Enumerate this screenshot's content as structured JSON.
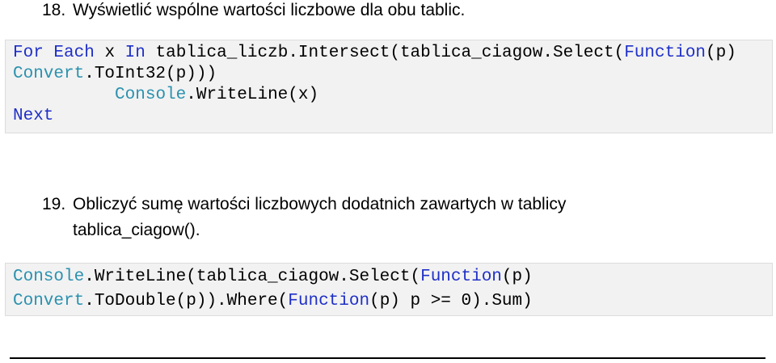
{
  "item18": {
    "number": "18.",
    "text": "Wyświetlić wspólne wartości liczbowe dla obu tablic."
  },
  "code1": {
    "line1": {
      "kw_for": "For",
      "kw_each": "Each",
      "t1": "x",
      "kw_in": "In",
      "t2": "tablica_liczb.Intersect(tablica_ciagow.Select(",
      "kw_function": "Function",
      "t3": "(p)"
    },
    "line2": {
      "ty_convert": "Convert",
      "t1": ".ToInt32(p)))"
    },
    "line3": {
      "ty_console": "Console",
      "t1": ".WriteLine(x)"
    },
    "line4": {
      "kw_next": "Next"
    }
  },
  "item19": {
    "number": "19.",
    "text": "Obliczyć sumę wartości liczbowych dodatnich zawartych w tablicy tablica_ciagow()."
  },
  "code2": {
    "line1": {
      "ty_console": "Console",
      "t1": ".WriteLine(tablica_ciagow.Select(",
      "kw_function": "Function",
      "t2": "(p)"
    },
    "line2": {
      "ty_convert": "Convert",
      "t1": ".ToDouble(p)).Where(",
      "kw_function": "Function",
      "t2": "(p) p >= 0).Sum)"
    }
  },
  "colors": {
    "keyword": "#1f30c8",
    "type": "#2b91af",
    "code_background": "#f2f2f2"
  }
}
